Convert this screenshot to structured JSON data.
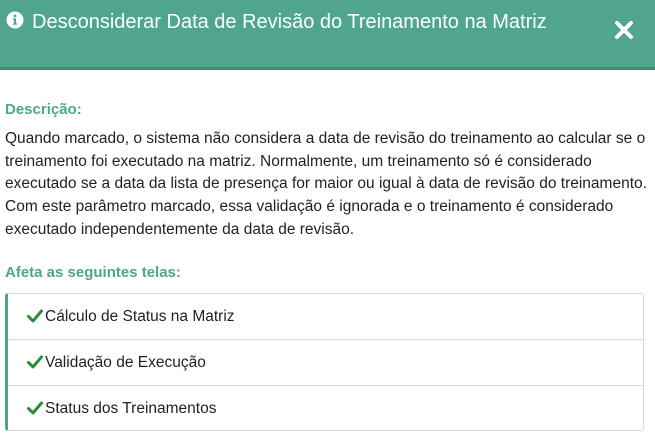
{
  "header": {
    "title": "Desconsiderar Data de Revisão do Treinamento na Matriz",
    "info_icon": "info-circle-icon",
    "close_icon": "close-icon"
  },
  "description": {
    "label": "Descrição:",
    "text": "Quando marcado, o sistema não considera a data de revisão do treinamento ao calcular se o treinamento foi executado na matriz. Normalmente, um treinamento só é considerado executado se a data da lista de presença for maior ou igual à data de revisão do treinamento. Com este parâmetro marcado, essa validação é ignorada e o treinamento é considerado executado independentemente da data de revisão."
  },
  "affected_screens": {
    "label": "Afeta as seguintes telas:",
    "item_icon": "check-icon",
    "items": [
      "Cálculo de Status na Matriz",
      "Validação de Execução",
      "Status dos Treinamentos"
    ]
  },
  "colors": {
    "accent": "#4fa58e",
    "accent_dark": "#3b8a75",
    "check": "#2e8b3e",
    "text": "#222222"
  }
}
